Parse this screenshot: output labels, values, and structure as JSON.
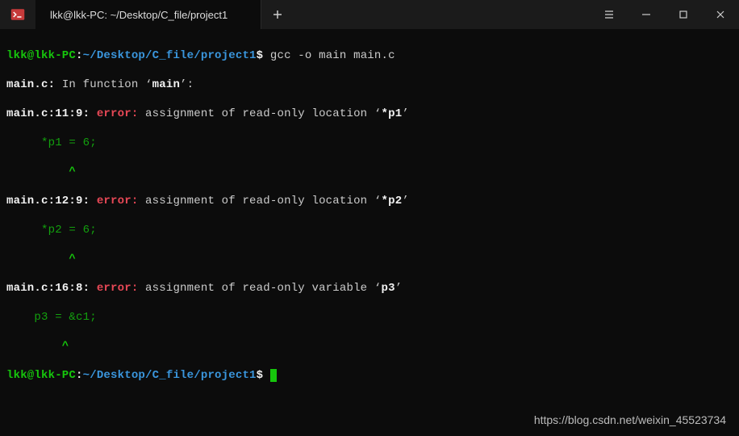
{
  "titlebar": {
    "tab_title": "lkk@lkk-PC: ~/Desktop/C_file/project1"
  },
  "prompt1": {
    "userhost": "lkk@lkk-PC",
    "colon": ":",
    "path": "~/Desktop/C_file/project1",
    "dollar": "$",
    "command": " gcc -o main main.c"
  },
  "err_intro": {
    "file": "main.c:",
    "text": " In function ‘",
    "func": "main",
    "after": "’:"
  },
  "err1": {
    "loc": "main.c:11:9:",
    "label": "error:",
    "msg": " assignment of read-only location ‘",
    "sym": "*p1",
    "after": "’",
    "code": "     *p1 = 6;",
    "caret": "         ^"
  },
  "err2": {
    "loc": "main.c:12:9:",
    "label": "error:",
    "msg": " assignment of read-only location ‘",
    "sym": "*p2",
    "after": "’",
    "code": "     *p2 = 6;",
    "caret": "         ^"
  },
  "err3": {
    "loc": "main.c:16:8:",
    "label": "error:",
    "msg": " assignment of read-only variable ‘",
    "sym": "p3",
    "after": "’",
    "code": "    p3 = &c1;",
    "caret": "        ^"
  },
  "prompt2": {
    "userhost": "lkk@lkk-PC",
    "colon": ":",
    "path": "~/Desktop/C_file/project1",
    "dollar": "$"
  },
  "watermark": "https://blog.csdn.net/weixin_45523734"
}
